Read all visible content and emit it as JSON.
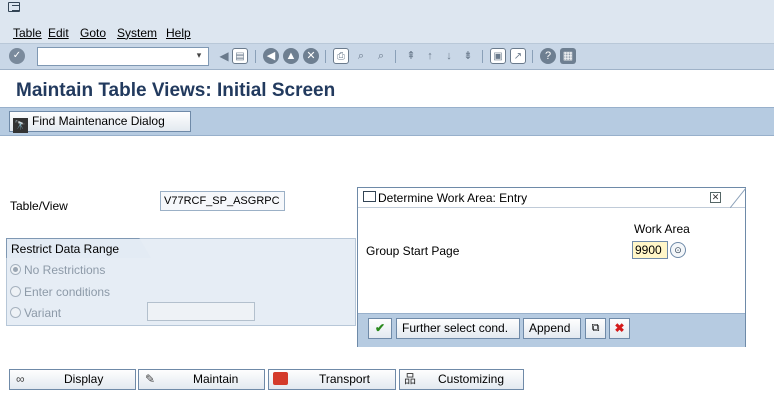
{
  "menubar": {
    "system_icon": "sap-system-menu-icon",
    "items": [
      "Table",
      "Edit",
      "Goto",
      "System",
      "Help"
    ]
  },
  "toolbar": {
    "command_field_value": "",
    "icons": [
      "enter-icon",
      "command-history-icon",
      "back-arrow-icon",
      "save-icon",
      "back-icon",
      "exit-icon",
      "cancel-icon",
      "print-icon",
      "find-icon",
      "find-next-icon",
      "first-page-icon",
      "previous-page-icon",
      "next-page-icon",
      "last-page-icon",
      "new-session-icon",
      "shortcut-icon",
      "help-icon",
      "customize-layout-icon"
    ]
  },
  "page": {
    "title": "Maintain Table Views: Initial Screen"
  },
  "app_toolbar": {
    "find_button_label": "Find Maintenance Dialog",
    "find_icon": "binoculars-icon"
  },
  "form": {
    "table_view_label": "Table/View",
    "table_view_value": "V77RCF_SP_ASGRPC"
  },
  "restrict": {
    "tab_label": "Restrict Data Range",
    "options": [
      "No Restrictions",
      "Enter conditions",
      "Variant"
    ],
    "selected": "No Restrictions",
    "variant_value": ""
  },
  "dialog": {
    "title": "Determine Work Area: Entry",
    "column_header": "Work Area",
    "field_label": "Group Start Page",
    "field_value": "9900",
    "buttons": {
      "further": "Further select cond.",
      "append": "Append"
    }
  },
  "bottom_buttons": {
    "display": "Display",
    "maintain": "Maintain",
    "transport": "Transport",
    "customizing": "Customizing"
  },
  "colors": {
    "title_text": "#223a5e",
    "toolbar_bg": "#c9d7e7",
    "app_toolbar_bg": "#b6cbe1",
    "field_highlight": "#fff6c8"
  }
}
